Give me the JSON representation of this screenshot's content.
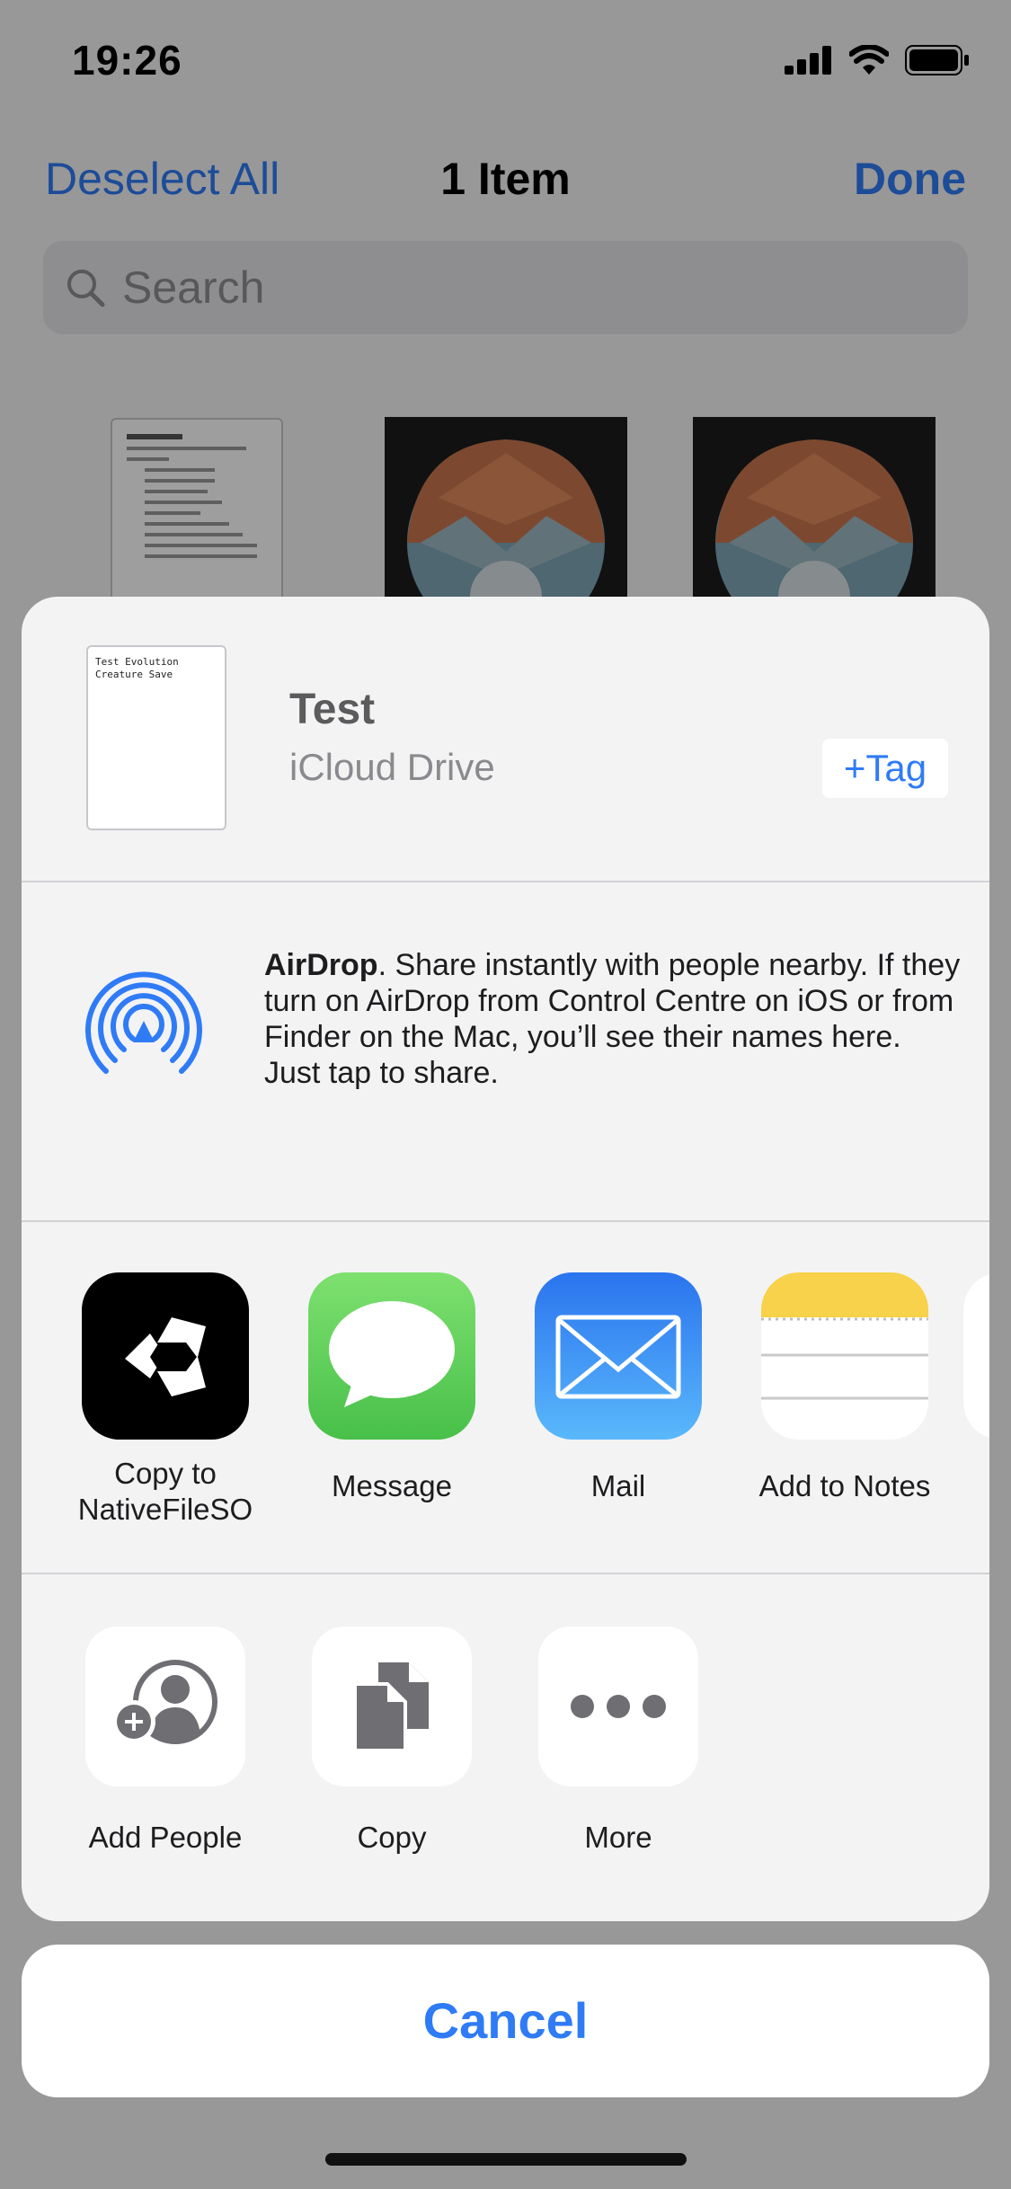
{
  "status_bar": {
    "time": "19:26",
    "icons": [
      "signal-icon",
      "wifi-icon",
      "battery-icon"
    ]
  },
  "nav": {
    "left_label": "Deselect All",
    "title": "1 Item",
    "right_label": "Done"
  },
  "search": {
    "placeholder": "Search"
  },
  "share_sheet": {
    "file": {
      "thumbnail_text": "Test Evolution\nCreature Save",
      "name": "Test",
      "location": "iCloud Drive",
      "tag_label": "+Tag"
    },
    "airdrop": {
      "title": "AirDrop",
      "description": ". Share instantly with people nearby. If they turn on AirDrop from Control Centre on iOS or from Finder on the Mac, you’ll see their names here. Just tap to share."
    },
    "apps": [
      {
        "label": "Copy to\nNativeFileSO",
        "icon": "unity-icon"
      },
      {
        "label": "Message",
        "icon": "messages-icon"
      },
      {
        "label": "Mail",
        "icon": "mail-icon"
      },
      {
        "label": "Add to Notes",
        "icon": "notes-icon"
      }
    ],
    "actions": [
      {
        "label": "Add People",
        "icon": "add-people-icon"
      },
      {
        "label": "Copy",
        "icon": "copy-icon"
      },
      {
        "label": "More",
        "icon": "more-icon"
      }
    ],
    "cancel_label": "Cancel"
  },
  "colors": {
    "accent": "#2f7bf6",
    "sheet_bg": "#f3f3f4",
    "messages_green": "#5bd25a",
    "mail_blue": "#3a8cf5",
    "notes_yellow": "#f7d24a"
  }
}
